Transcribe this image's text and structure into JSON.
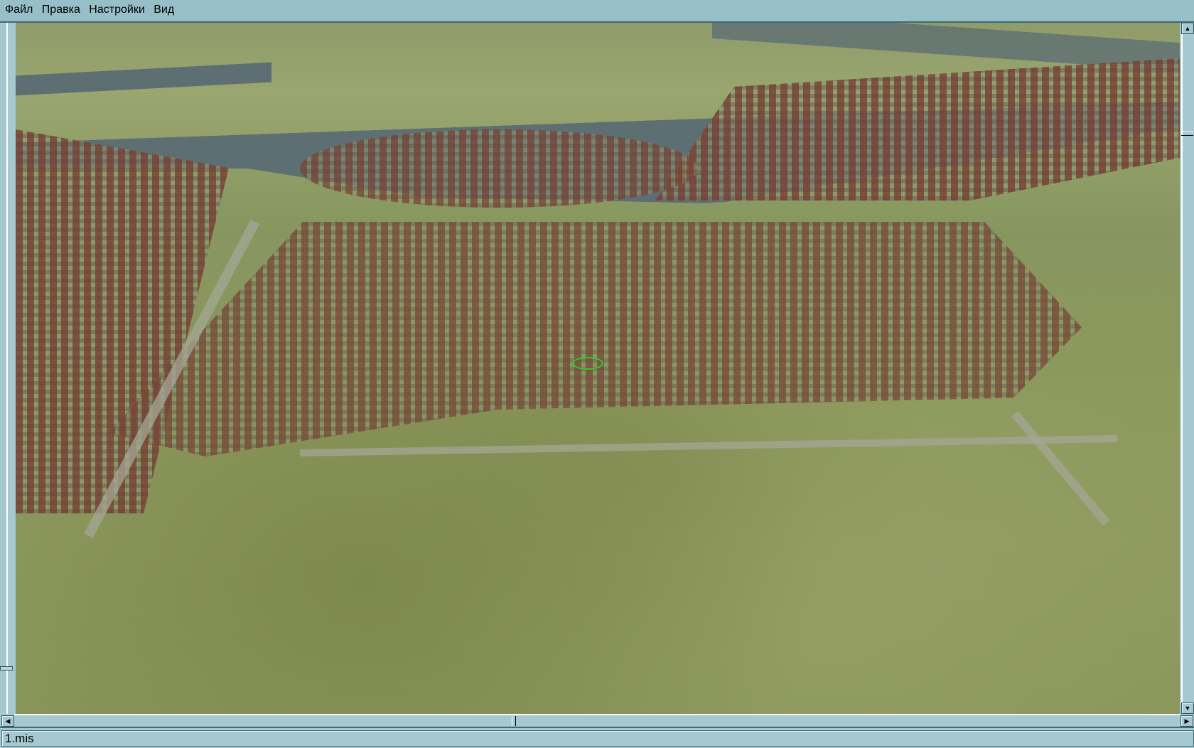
{
  "menu": {
    "items": [
      "Файл",
      "Правка",
      "Настройки",
      "Вид"
    ]
  },
  "status": {
    "text": "1.mis"
  },
  "scrollbars": {
    "vertical_position": 0.13,
    "horizontal_position": 0.43
  }
}
